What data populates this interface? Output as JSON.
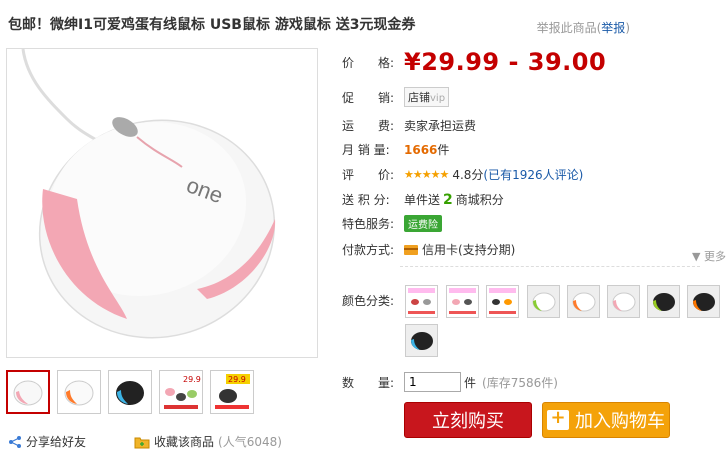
{
  "title": "包邮！微绅I1可爱鸡蛋有线鼠标 USB鼠标 游戏鼠标 送3元现金券",
  "report": {
    "prefix": "举报此商品",
    "open": "(",
    "link": "举报",
    "close": ")"
  },
  "price": {
    "label": "价　　格:",
    "value": "¥29.99 - 39.00"
  },
  "promo": {
    "label": "促　　销:",
    "shop": "店铺",
    "vip": "vip"
  },
  "shipping": {
    "label": "运　　费:",
    "value": "卖家承担运费"
  },
  "sales": {
    "label": "月 销 量:",
    "count": "1666",
    "unit": "件"
  },
  "rating": {
    "label": "评　　价:",
    "stars": "★★★★★",
    "score": "4.8分",
    "reviews": "(已有1926人评论)"
  },
  "points": {
    "label": "送 积 分:",
    "prefix": "单件送",
    "value": "2",
    "suffix": "商城积分"
  },
  "services": {
    "label": "特色服务:",
    "badge": "运费险"
  },
  "payment": {
    "label": "付款方式:",
    "value": "信用卡(支持分期)",
    "more": "▼ 更多"
  },
  "color": {
    "label": "颜色分类:"
  },
  "quantity": {
    "label": "数　　量:",
    "value": "1",
    "unit": "件",
    "stock": "(库存7586件)"
  },
  "buttons": {
    "buy": "立刻购买",
    "cart": "加入购物车"
  },
  "share": {
    "label": "分享给好友"
  },
  "favorite": {
    "label": "收藏该商品",
    "popularity": "(人气6048)"
  },
  "colors": {
    "accent": "#c40000",
    "buy": "#c8161d",
    "cart": "#f4a20a"
  }
}
